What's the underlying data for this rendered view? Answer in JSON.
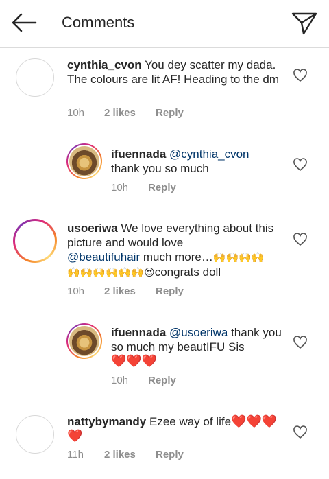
{
  "header": {
    "title": "Comments"
  },
  "comments": [
    {
      "username": "cynthia_cvon",
      "text": "You dey scatter my dada. The colours are lit AF! Heading to the dm",
      "time": "10h",
      "likes": "2 likes",
      "reply": "Reply"
    },
    {
      "username": "ifuennada",
      "mention": "@cynthia_cvon",
      "text": "thank you so much",
      "time": "10h",
      "reply": "Reply"
    },
    {
      "username": "usoeriwa",
      "text1": "We love everything about this picture and would love",
      "mention": "@beautifuhair",
      "text2": "much more…",
      "emoji1": "🙌🙌🙌🙌",
      "emoji2": "🙌🙌🙌🙌🙌🙌",
      "emoji3": "😍",
      "text3": "congrats doll",
      "time": "10h",
      "likes": "2 likes",
      "reply": "Reply"
    },
    {
      "username": "ifuennada",
      "mention": "@usoeriwa",
      "text": "thank you so much my beautIFU Sis",
      "hearts": "❤️❤️❤️",
      "time": "10h",
      "reply": "Reply"
    },
    {
      "username": "nattybymandy",
      "text": "Ezee way of life",
      "hearts": "❤️❤️❤️❤️",
      "time": "11h",
      "likes": "2 likes",
      "reply": "Reply"
    }
  ],
  "colors": {
    "text": "#262626",
    "mention": "#003569",
    "meta": "#8e8e8e",
    "divider": "#dbdbdb"
  }
}
